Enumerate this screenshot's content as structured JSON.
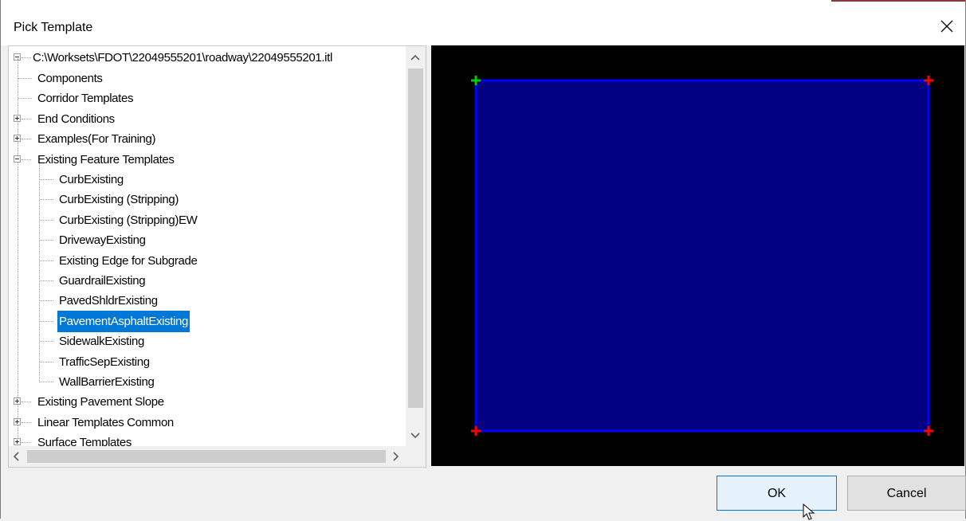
{
  "window": {
    "title": "Pick Template"
  },
  "colors": {
    "selection": "#0078d7",
    "preview_background": "#000000",
    "preview_fill": "#000080",
    "preview_outline": "#0000ff",
    "origin_marker": "#00cc00",
    "point_marker": "#ff0000"
  },
  "tree": {
    "root": "C:\\Worksets\\FDOT\\22049555201\\roadway\\22049555201.itl",
    "items": [
      {
        "label": "Components",
        "level": 1,
        "expander": "none"
      },
      {
        "label": "Corridor Templates",
        "level": 1,
        "expander": "none"
      },
      {
        "label": "End Conditions",
        "level": 1,
        "expander": "plus"
      },
      {
        "label": "Examples(For Training)",
        "level": 1,
        "expander": "plus"
      },
      {
        "label": "Existing Feature Templates",
        "level": 1,
        "expander": "minus"
      },
      {
        "label": "CurbExisting",
        "level": 2,
        "expander": "none"
      },
      {
        "label": "CurbExisting (Stripping)",
        "level": 2,
        "expander": "none"
      },
      {
        "label": "CurbExisting (Stripping)EW",
        "level": 2,
        "expander": "none"
      },
      {
        "label": "DrivewayExisting",
        "level": 2,
        "expander": "none"
      },
      {
        "label": "Existing Edge for Subgrade",
        "level": 2,
        "expander": "none"
      },
      {
        "label": "GuardrailExisting",
        "level": 2,
        "expander": "none"
      },
      {
        "label": "PavedShldrExisting",
        "level": 2,
        "expander": "none"
      },
      {
        "label": "PavementAsphaltExisting",
        "level": 2,
        "expander": "none",
        "selected": true
      },
      {
        "label": "SidewalkExisting",
        "level": 2,
        "expander": "none"
      },
      {
        "label": "TrafficSepExisting",
        "level": 2,
        "expander": "none"
      },
      {
        "label": "WallBarrierExisting",
        "level": 2,
        "expander": "none"
      },
      {
        "label": "Existing Pavement Slope",
        "level": 1,
        "expander": "plus"
      },
      {
        "label": "Linear Templates Common",
        "level": 1,
        "expander": "plus"
      },
      {
        "label": "Surface Templates",
        "level": 1,
        "expander": "plus"
      }
    ]
  },
  "buttons": {
    "ok": "OK",
    "cancel": "Cancel"
  },
  "icons": {
    "close": "close-icon",
    "scroll_up": "chevron-up-icon",
    "scroll_down": "chevron-down-icon",
    "scroll_left": "chevron-left-icon",
    "scroll_right": "chevron-right-icon"
  }
}
